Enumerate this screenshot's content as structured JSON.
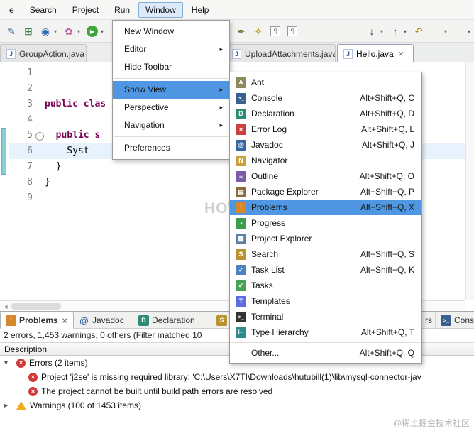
{
  "colors": {
    "menu-highlight": "#4f97e3",
    "keyword": "#7b0052",
    "error": "#cf3b3b",
    "warning": "#f2b01e",
    "range-marker": "#86cfd4",
    "current-line": "#e7f2fc",
    "tab-active-border": "#9aa3b5"
  },
  "watermark": {
    "center": "HOW",
    "corner": "@稀土掘金技术社区"
  },
  "menubar": {
    "file_partial": "e",
    "search": "Search",
    "project": "Project",
    "run": "Run",
    "window": "Window",
    "help": "Help"
  },
  "toolbar": {
    "icons": [
      "pencil-icon",
      "table-icon",
      "web-browser-icon",
      "chevron-down-icon",
      "new-wizard-icon",
      "chevron-down-icon",
      "run-icon",
      "feather-pen-icon",
      "wand-icon",
      "mark-occurrences-icon",
      "show-whitespace-icon",
      "next-annotation-icon",
      "chevron-down-icon",
      "previous-annotation-icon",
      "chevron-down-icon",
      "last-edit-location-icon",
      "back-icon",
      "chevron-down-icon",
      "forward-icon",
      "chevron-down-icon"
    ]
  },
  "window_menu": {
    "new_window": "New Window",
    "editor": "Editor",
    "hide_toolbar": "Hide Toolbar",
    "show_view": "Show View",
    "perspective": "Perspective",
    "navigation": "Navigation",
    "preferences": "Preferences"
  },
  "show_view_menu": {
    "items": [
      {
        "label": "Ant",
        "shortcut": "",
        "icon": "ant-icon"
      },
      {
        "label": "Console",
        "shortcut": "Alt+Shift+Q, C",
        "icon": "console-icon"
      },
      {
        "label": "Declaration",
        "shortcut": "Alt+Shift+Q, D",
        "icon": "declaration-icon"
      },
      {
        "label": "Error Log",
        "shortcut": "Alt+Shift+Q, L",
        "icon": "error-log-icon"
      },
      {
        "label": "Javadoc",
        "shortcut": "Alt+Shift+Q, J",
        "icon": "javadoc-icon"
      },
      {
        "label": "Navigator",
        "shortcut": "",
        "icon": "navigator-icon"
      },
      {
        "label": "Outline",
        "shortcut": "Alt+Shift+Q, O",
        "icon": "outline-icon"
      },
      {
        "label": "Package Explorer",
        "shortcut": "Alt+Shift+Q, P",
        "icon": "package-explorer-icon"
      },
      {
        "label": "Problems",
        "shortcut": "Alt+Shift+Q, X",
        "icon": "problems-icon",
        "highlighted": true
      },
      {
        "label": "Progress",
        "shortcut": "",
        "icon": "progress-icon"
      },
      {
        "label": "Project Explorer",
        "shortcut": "",
        "icon": "project-explorer-icon"
      },
      {
        "label": "Search",
        "shortcut": "Alt+Shift+Q, S",
        "icon": "search-icon"
      },
      {
        "label": "Task List",
        "shortcut": "Alt+Shift+Q, K",
        "icon": "task-list-icon"
      },
      {
        "label": "Tasks",
        "shortcut": "",
        "icon": "tasks-icon"
      },
      {
        "label": "Templates",
        "shortcut": "",
        "icon": "templates-icon"
      },
      {
        "label": "Terminal",
        "shortcut": "",
        "icon": "terminal-icon"
      },
      {
        "label": "Type Hierarchy",
        "shortcut": "Alt+Shift+Q, T",
        "icon": "type-hierarchy-icon"
      },
      {
        "label": "Other...",
        "shortcut": "Alt+Shift+Q, Q",
        "icon": "none"
      }
    ]
  },
  "editor_tabs": [
    {
      "label": "GroupAction.java"
    },
    {
      "label": "UploadAttachments.java"
    },
    {
      "label": "Hello.java",
      "active": true
    }
  ],
  "editor": {
    "lines": [
      {
        "num": "1",
        "code": ""
      },
      {
        "num": "2",
        "code": ""
      },
      {
        "num": "3",
        "code": "public clas"
      },
      {
        "num": "4",
        "code": ""
      },
      {
        "num": "5",
        "code": "  public s"
      },
      {
        "num": "6",
        "code": "    Syst"
      },
      {
        "num": "7",
        "code": "  }"
      },
      {
        "num": "8",
        "code": "}"
      },
      {
        "num": "9",
        "code": ""
      }
    ]
  },
  "problems_panel": {
    "tabs": {
      "problems": "Problems",
      "javadoc": "Javadoc",
      "declaration": "Declaration",
      "partial_se": "Se",
      "partial_rs": "rs",
      "console": "Console"
    },
    "summary": "2 errors, 1,453 warnings, 0 others (Filter matched 10",
    "column_header": "Description",
    "rows": [
      {
        "label": "Errors (2 items)",
        "type": "error-group",
        "expanded": true
      },
      {
        "label": "Project 'j2se' is missing required library: 'C:\\Users\\X7TI\\Downloads\\hutubill(1)\\lib\\mysql-connector-jav",
        "type": "error"
      },
      {
        "label": "The project cannot be built until build path errors are resolved",
        "type": "error"
      },
      {
        "label": "Warnings (100 of 1453 items)",
        "type": "warning-group",
        "expanded": false
      }
    ]
  }
}
